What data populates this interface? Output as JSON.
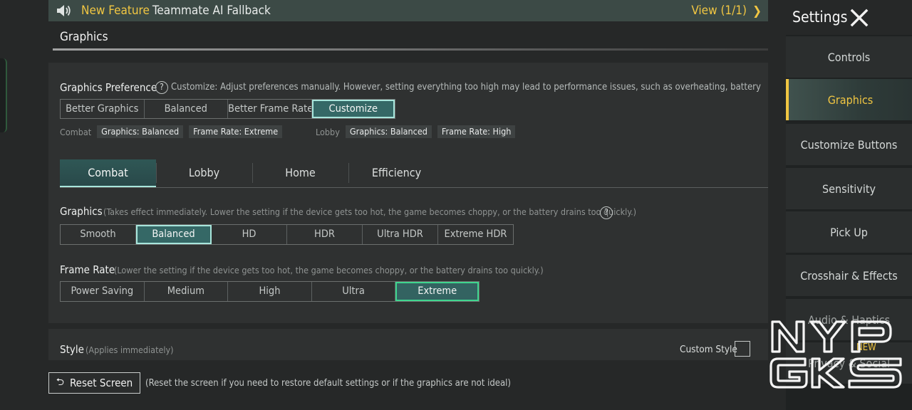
{
  "banner": {
    "new_label": "New Feature",
    "title": "Teammate AI Fallback",
    "view_label": "View (1/1)",
    "icon": "speaker-icon"
  },
  "section": {
    "title": "Graphics"
  },
  "graphics_preference": {
    "label": "Graphics Preference",
    "description": "Customize: Adjust preferences manually. However, setting everything too high may lead to performance issues, such as overheating, battery drain, or ch",
    "options": [
      "Better Graphics",
      "Balanced",
      "Better Frame Rate",
      "Customize"
    ],
    "selected": "Customize",
    "combat": {
      "label": "Combat",
      "graphics": "Graphics: Balanced",
      "frame_rate": "Frame Rate: Extreme"
    },
    "lobby": {
      "label": "Lobby",
      "graphics": "Graphics: Balanced",
      "frame_rate": "Frame Rate: High"
    }
  },
  "tabs": [
    "Combat",
    "Lobby",
    "Home",
    "Efficiency"
  ],
  "active_tab": "Combat",
  "graphics": {
    "label": "Graphics",
    "description": "(Takes effect immediately. Lower the setting if the device gets too hot, the game becomes choppy, or the battery drains too quickly.)",
    "options": [
      "Smooth",
      "Balanced",
      "HD",
      "HDR",
      "Ultra HDR",
      "Extreme HDR"
    ],
    "selected": "Balanced"
  },
  "frame_rate": {
    "label": "Frame Rate",
    "description": "(Lower the setting if the device gets too hot, the game becomes choppy, or the battery drains too quickly.)",
    "options": [
      "Power Saving",
      "Medium",
      "High",
      "Ultra",
      "Extreme"
    ],
    "selected": "Extreme"
  },
  "style": {
    "label": "Style",
    "description": "(Applies immediately)",
    "custom_style_label": "Custom Style",
    "custom_style_checked": false
  },
  "reset": {
    "button_label": "Reset Screen",
    "description": "(Reset the screen if you need to restore default settings or if the graphics are not ideal)"
  },
  "settings": {
    "title": "Settings",
    "nav": [
      "Controls",
      "Graphics",
      "Customize Buttons",
      "Sensitivity",
      "Pick Up",
      "Crosshair & Effects",
      "Audio & Haptics",
      "Privacy & Social"
    ],
    "active": "Graphics",
    "new_badge": "NEW"
  },
  "watermark": {
    "line1": "NYP",
    "line2": "GKS"
  },
  "colors": {
    "accent_yellow": "#f1c642",
    "selected_teal": "#356866",
    "selected_outline": "#a8e6dc",
    "selected_green_outline": "#3fd58e"
  }
}
